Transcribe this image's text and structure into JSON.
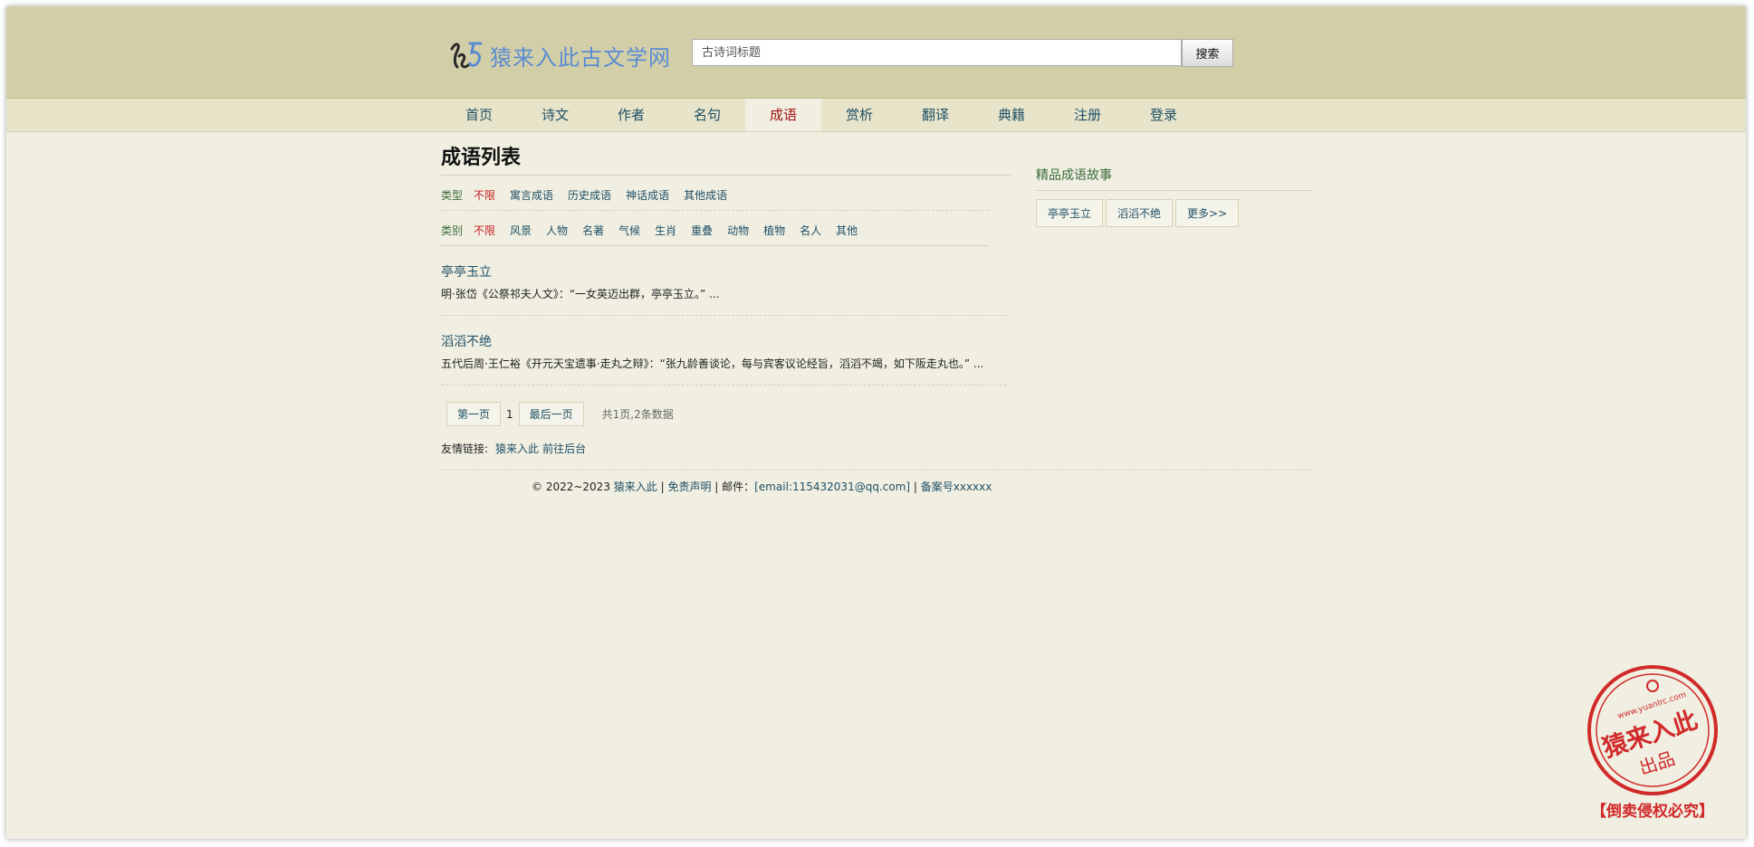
{
  "site": {
    "logo_text": "猿来入此古文学网"
  },
  "search": {
    "placeholder": "古诗词标题",
    "button_label": "搜索"
  },
  "nav": {
    "items": [
      {
        "label": "首页"
      },
      {
        "label": "诗文"
      },
      {
        "label": "作者"
      },
      {
        "label": "名句"
      },
      {
        "label": "成语",
        "active": true
      },
      {
        "label": "赏析"
      },
      {
        "label": "翻译"
      },
      {
        "label": "典籍"
      },
      {
        "label": "注册"
      },
      {
        "label": "登录"
      }
    ]
  },
  "main": {
    "title": "成语列表",
    "type_filter": {
      "label": "类型",
      "options": [
        {
          "label": "不限",
          "active": true
        },
        {
          "label": "寓言成语"
        },
        {
          "label": "历史成语"
        },
        {
          "label": "神话成语"
        },
        {
          "label": "其他成语"
        }
      ]
    },
    "category_filter": {
      "label": "类别",
      "options": [
        {
          "label": "不限",
          "active": true
        },
        {
          "label": "风景"
        },
        {
          "label": "人物"
        },
        {
          "label": "名著"
        },
        {
          "label": "气候"
        },
        {
          "label": "生肖"
        },
        {
          "label": "重叠"
        },
        {
          "label": "动物"
        },
        {
          "label": "植物"
        },
        {
          "label": "名人"
        },
        {
          "label": "其他"
        }
      ]
    },
    "entries": [
      {
        "title": "亭亭玉立",
        "desc": "明·张岱《公祭祁夫人文》：“一女英迈出群，亭亭玉立。” ..."
      },
      {
        "title": "滔滔不绝",
        "desc": "五代后周·王仁裕《开元天宝遗事·走丸之辩》：“张九龄善谈论，每与宾客议论经旨，滔滔不竭，如下阪走丸也。” ..."
      }
    ],
    "pager": {
      "first": "第一页",
      "current": "1",
      "last": "最后一页",
      "info": "共1页,2条数据"
    },
    "friend": {
      "label": "友情链接:",
      "links": [
        "猿来入此",
        "前往后台"
      ]
    }
  },
  "sidebar": {
    "title": "精品成语故事",
    "tags": [
      "亭亭玉立",
      "滔滔不绝",
      "更多>>"
    ]
  },
  "footer": {
    "copyright": "© 2022~2023",
    "site_link": "猿来入此",
    "sep1": " | ",
    "disclaimer": "免责声明",
    "sep2": " | 邮件：",
    "email": "[email:115432031@qq.com]",
    "sep3": " | ",
    "icp": "备案号xxxxxx"
  },
  "stamp": {
    "url": "www.yuanlrc.com",
    "line1": "猿来入此",
    "line2": "出品",
    "banner": "【倒卖侵权必究】"
  },
  "colors": {
    "header_bg": "#d2cfa8",
    "nav_bg": "#e7e4ca",
    "page_bg": "#f0efe2",
    "link": "#1f4f66",
    "active": "#c42020",
    "logo": "#5a8bd2",
    "stamp": "#d12a2a"
  }
}
